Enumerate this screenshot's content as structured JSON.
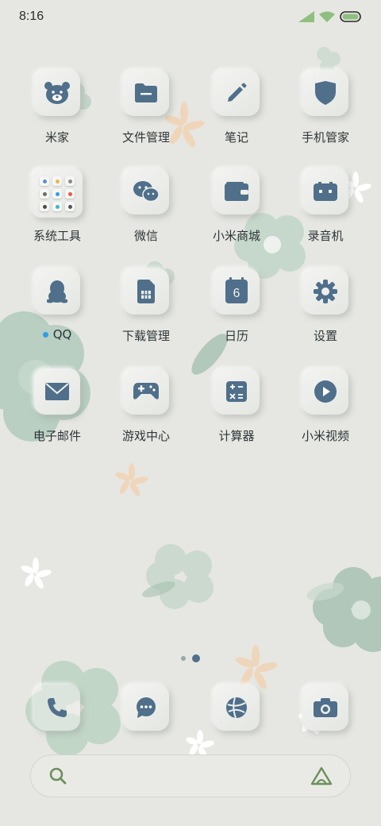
{
  "status_bar": {
    "time": "8:16",
    "signal_icon": "signal-icon",
    "wifi_icon": "wifi-icon",
    "battery_icon": "battery-icon",
    "battery_color": "#8fbf7f"
  },
  "apps": [
    {
      "label": "米家",
      "icon": "bear-icon"
    },
    {
      "label": "文件管理",
      "icon": "folder-icon"
    },
    {
      "label": "笔记",
      "icon": "pencil-icon"
    },
    {
      "label": "手机管家",
      "icon": "shield-icon"
    },
    {
      "label": "系统工具",
      "icon": "tools-folder-icon"
    },
    {
      "label": "微信",
      "icon": "wechat-icon"
    },
    {
      "label": "小米商城",
      "icon": "wallet-icon"
    },
    {
      "label": "录音机",
      "icon": "recorder-icon"
    },
    {
      "label": "QQ",
      "icon": "penguin-icon"
    },
    {
      "label": "下载管理",
      "icon": "sim-card-icon"
    },
    {
      "label": "日历",
      "icon": "calendar-icon",
      "day": "6"
    },
    {
      "label": "设置",
      "icon": "gear-icon"
    },
    {
      "label": "电子邮件",
      "icon": "mail-icon"
    },
    {
      "label": "游戏中心",
      "icon": "gamepad-icon"
    },
    {
      "label": "计算器",
      "icon": "calculator-icon"
    },
    {
      "label": "小米视频",
      "icon": "play-icon"
    }
  ],
  "dock": [
    {
      "icon": "phone-icon"
    },
    {
      "icon": "message-icon"
    },
    {
      "icon": "browser-icon"
    },
    {
      "icon": "camera-icon"
    }
  ],
  "pager": {
    "pages": 2,
    "active": 2
  },
  "search": {
    "search_icon": "search-icon",
    "assistant_icon": "assistant-icon"
  },
  "colors": {
    "icon_blue": "#4f6f8a",
    "accent_green": "#6e8f5c",
    "background": "#e6e7e2"
  }
}
